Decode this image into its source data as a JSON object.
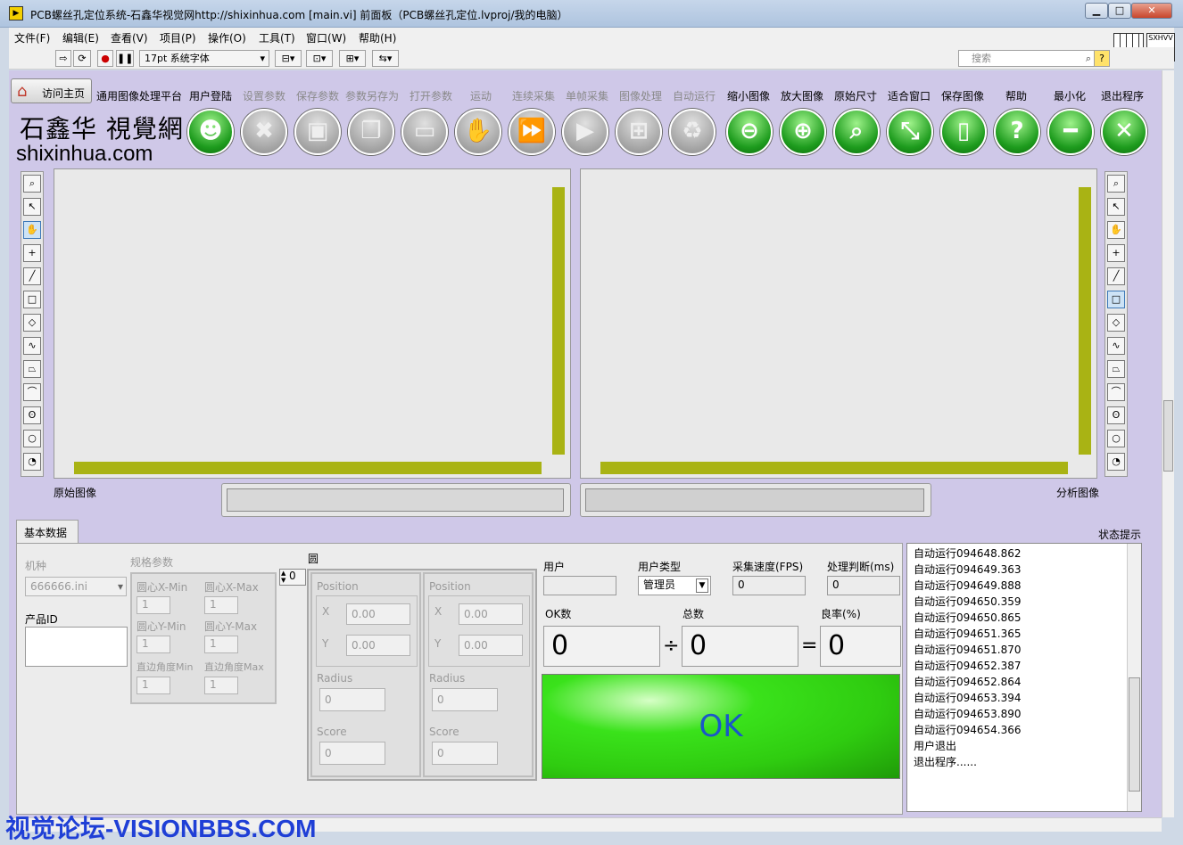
{
  "window": {
    "title": "PCB螺丝孔定位系统-石鑫华视觉网http://shixinhua.com [main.vi] 前面板（PCB螺丝孔定位.lvproj/我的电脑）"
  },
  "menu": [
    "文件(F)",
    "编辑(E)",
    "查看(V)",
    "项目(P)",
    "操作(O)",
    "工具(T)",
    "窗口(W)",
    "帮助(H)"
  ],
  "toolbar": {
    "font": "17pt 系统字体",
    "search_placeholder": "搜索"
  },
  "home_button": "访问主页",
  "toolbar_labels": [
    "通用图像处理平台",
    "用户登陆",
    "设置参数",
    "保存参数",
    "参数另存为",
    "打开参数",
    "运动",
    "连续采集",
    "单帧采集",
    "图像处理",
    "自动运行",
    "缩小图像",
    "放大图像",
    "原始尺寸",
    "适合窗口",
    "保存图像",
    "帮助",
    "最小化",
    "退出程序"
  ],
  "toolbar_enabled": [
    true,
    true,
    false,
    false,
    false,
    false,
    false,
    false,
    false,
    false,
    false,
    true,
    true,
    true,
    true,
    true,
    true,
    true,
    true
  ],
  "logo": {
    "calligraphy": "石鑫华 視覺網",
    "domain": "shixinhua.com"
  },
  "displays": {
    "left_label": "原始图像",
    "right_label": "分析图像"
  },
  "tabs": {
    "active": "基本数据"
  },
  "status_label": "状态提示",
  "form": {
    "model_label": "机种",
    "model_value": "666666.ini",
    "product_id_label": "产品ID",
    "product_id_value": "",
    "spec_label": "规格参数",
    "spec": {
      "cx_min_label": "圆心X-Min",
      "cx_max_label": "圆心X-Max",
      "cy_min_label": "圆心Y-Min",
      "cy_max_label": "圆心Y-Max",
      "ang_min_label": "直边角度Min",
      "ang_max_label": "直边角度Max",
      "cx_min": "1",
      "cx_max": "1",
      "cy_min": "1",
      "cy_max": "1",
      "ang_min": "1",
      "ang_max": "1"
    },
    "index_value": "0",
    "circle_label": "圆",
    "circle": {
      "position_label": "Position",
      "x_label": "X",
      "y_label": "Y",
      "radius_label": "Radius",
      "score_label": "Score",
      "x": "0.00",
      "y": "0.00",
      "radius": "0",
      "score": "0"
    },
    "user_label": "用户",
    "user_value": "",
    "user_type_label": "用户类型",
    "user_type_value": "管理员",
    "fps_label": "采集速度(FPS)",
    "fps_value": "0",
    "proc_label": "处理判断(ms)",
    "proc_value": "0",
    "ok_count_label": "OK数",
    "ok_count": "0",
    "total_label": "总数",
    "total": "0",
    "yield_label": "良率(%)",
    "yield": "0",
    "div_symbol": "÷",
    "eq_symbol": "=",
    "result": "OK"
  },
  "log": [
    "自动运行094648.862",
    "自动运行094649.363",
    "自动运行094649.888",
    "自动运行094650.359",
    "自动运行094650.865",
    "自动运行094651.365",
    "自动运行094651.870",
    "自动运行094652.387",
    "自动运行094652.864",
    "自动运行094653.394",
    "自动运行094653.890",
    "自动运行094654.366",
    "用户退出",
    "退出程序......"
  ],
  "watermark": "视觉论坛-VISIONBBS.COM",
  "colors": {
    "panel": "#cfc8e8",
    "button_green": "#1e9c1e",
    "ok_green": "#33dd11",
    "ok_text": "#1a57c9",
    "display_bar": "#a9b314"
  }
}
